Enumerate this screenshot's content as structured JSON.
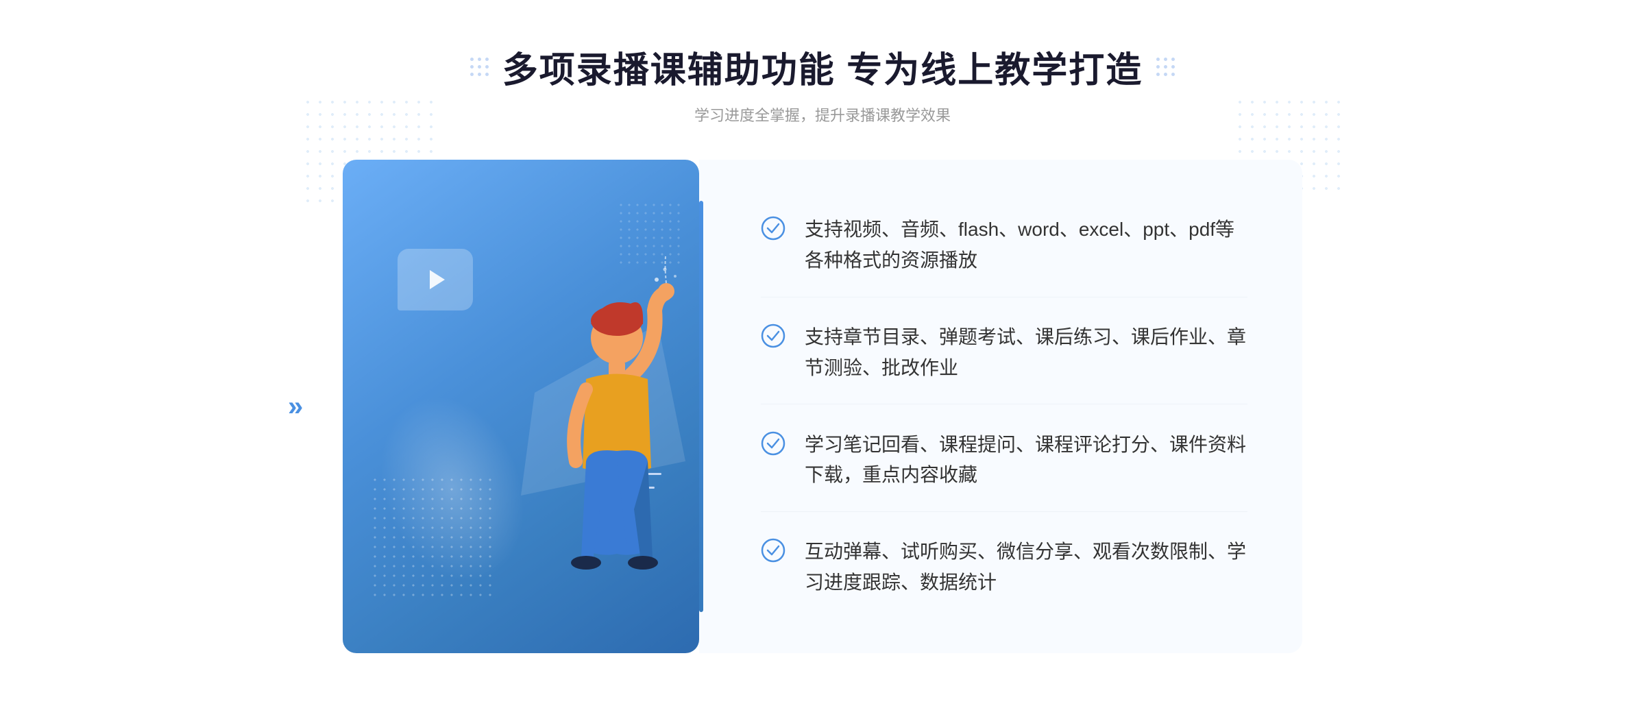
{
  "header": {
    "title": "多项录播课辅助功能 专为线上教学打造",
    "subtitle": "学习进度全掌握，提升录播课教学效果",
    "title_dots_label": "title-decoration-dots"
  },
  "features": [
    {
      "id": 1,
      "text": "支持视频、音频、flash、word、excel、ppt、pdf等各种格式的资源播放"
    },
    {
      "id": 2,
      "text": "支持章节目录、弹题考试、课后练习、课后作业、章节测验、批改作业"
    },
    {
      "id": 3,
      "text": "学习笔记回看、课程提问、课程评论打分、课件资料下载，重点内容收藏"
    },
    {
      "id": 4,
      "text": "互动弹幕、试听购买、微信分享、观看次数限制、学习进度跟踪、数据统计"
    }
  ],
  "colors": {
    "primary_blue": "#4a90e2",
    "light_blue": "#6baef6",
    "dark_text": "#1a1a2e",
    "body_text": "#333333",
    "subtitle_text": "#999999",
    "bg_light": "#f8fbff"
  },
  "check_icon_label": "check-circle-icon",
  "decorations": {
    "chevrons_label": "»"
  }
}
